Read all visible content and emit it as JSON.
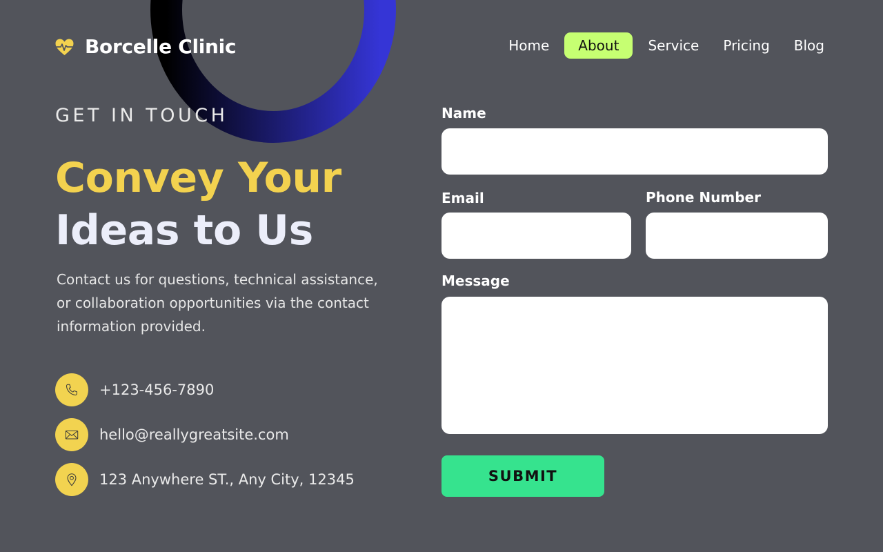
{
  "brand": {
    "name": "Borcelle Clinic",
    "logo_icon": "heart-pulse-icon",
    "accent_color": "#f3d24f"
  },
  "nav": {
    "items": [
      {
        "label": "Home"
      },
      {
        "label": "About"
      },
      {
        "label": "Service"
      },
      {
        "label": "Pricing"
      },
      {
        "label": "Blog"
      }
    ],
    "active": "About",
    "active_color": "#c6ff72"
  },
  "hero": {
    "eyebrow": "GET IN TOUCH",
    "headline_line1": "Convey Your",
    "headline_line2": "Ideas to Us",
    "description": "Contact us for questions, technical assistance, or collaboration opportunities via the contact information provided."
  },
  "contacts": [
    {
      "icon": "phone-icon",
      "text": "+123-456-7890"
    },
    {
      "icon": "mail-icon",
      "text": "hello@reallygreatsite.com"
    },
    {
      "icon": "location-pin-icon",
      "text": "123 Anywhere ST., Any City, 12345"
    }
  ],
  "form": {
    "name_label": "Name",
    "name_value": "",
    "email_label": "Email",
    "email_value": "",
    "phone_label": "Phone Number",
    "phone_value": "",
    "message_label": "Message",
    "message_value": "",
    "submit_label": "SUBMIT",
    "submit_color": "#36e38e"
  },
  "colors": {
    "background": "#52545b",
    "headline_secondary": "#eceefa",
    "contact_icon_bg": "#f2d350",
    "ring_gradient": [
      "#000000",
      "#3535d6"
    ]
  }
}
